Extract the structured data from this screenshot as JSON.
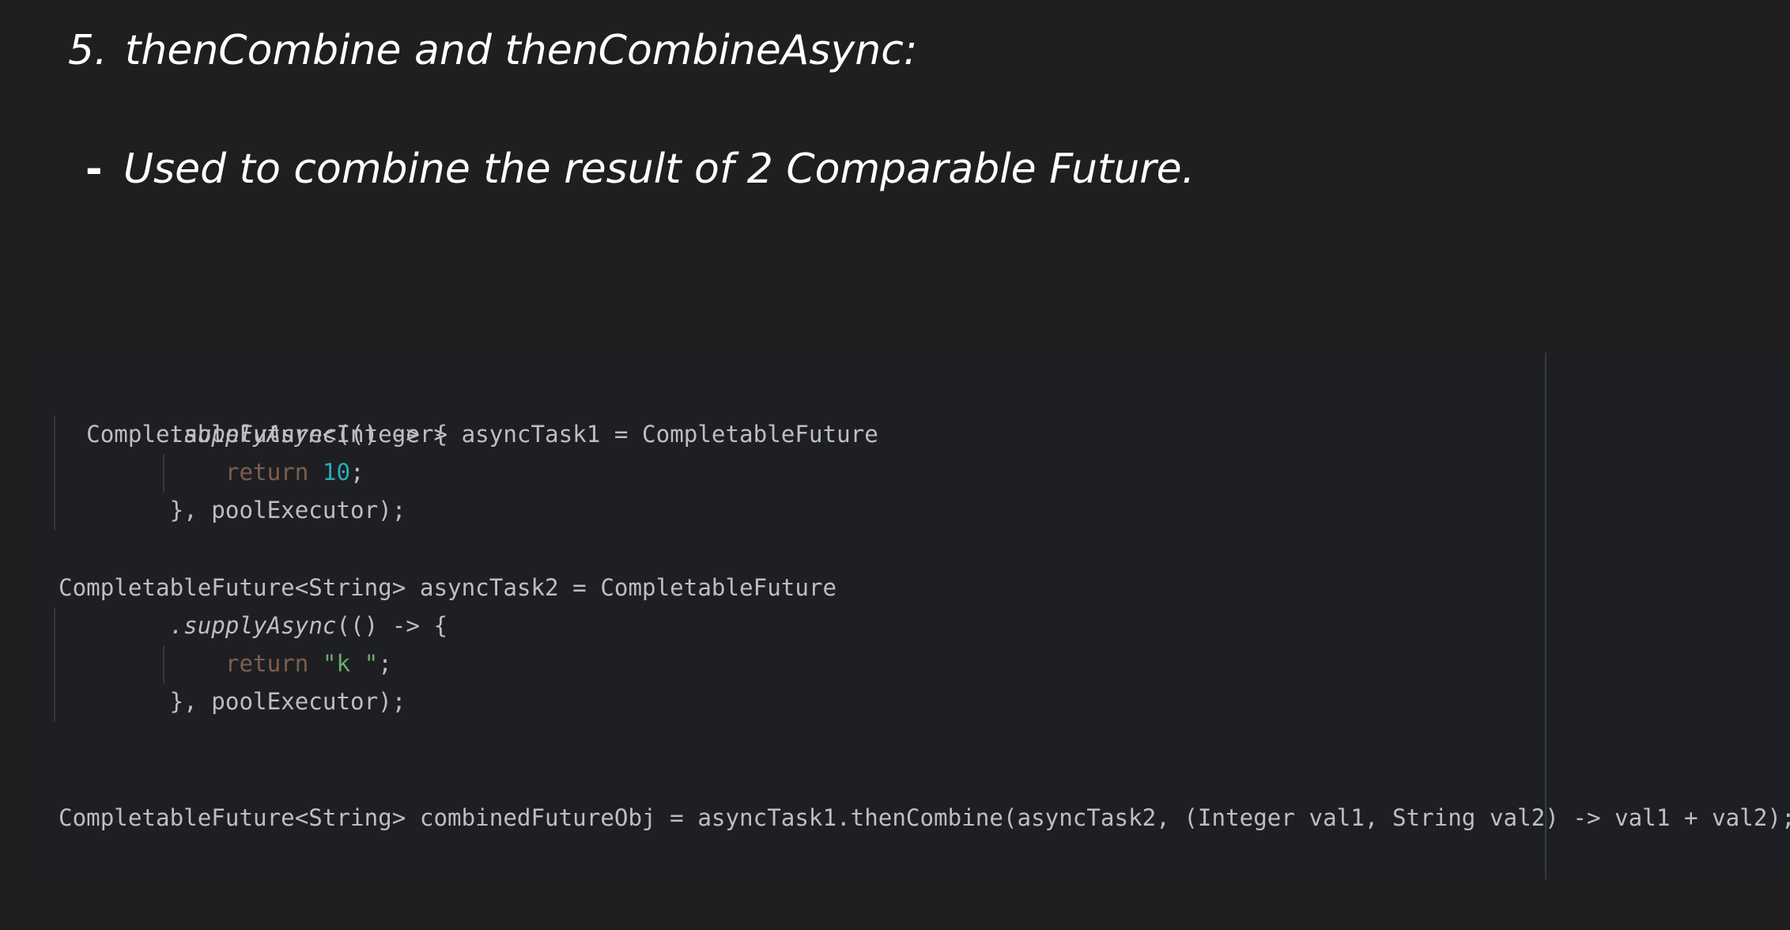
{
  "slide": {
    "heading_number": "5.",
    "heading_text": "thenCombine and thenCombineAsync:",
    "bullet_dash": "-",
    "bullet_text": "Used to combine the result of 2 Comparable Future."
  },
  "code": {
    "block1": {
      "line1": "CompletableFuture<Integer> asyncTask1 = CompletableFuture",
      "line2_indent": "        ",
      "line2_method": ".supplyAsync",
      "line2_rest": "(() -> {",
      "line3_indent": "            ",
      "line3_keyword": "return",
      "line3_space": " ",
      "line3_value": "10",
      "line3_end": ";",
      "line4": "        }, poolExecutor);"
    },
    "block2": {
      "line1": "CompletableFuture<String> asyncTask2 = CompletableFuture",
      "line2_indent": "        ",
      "line2_method": ".supplyAsync",
      "line2_rest": "(() -> {",
      "line3_indent": "            ",
      "line3_keyword": "return",
      "line3_space": " ",
      "line3_value": "\"k \"",
      "line3_end": ";",
      "line4": "        }, poolExecutor);"
    },
    "combine_line": "CompletableFuture<String> combinedFutureObj = asyncTask1.thenCombine(asyncTask2, (Integer val1, String val2) -> val1 + val2);"
  },
  "colors": {
    "background": "#1f1f1f",
    "code_background": "#1e1f22",
    "code_text": "#bcbec4",
    "keyword": "#cf8e6d",
    "number_literal": "#2aacb8",
    "string_literal": "#6aab73"
  }
}
